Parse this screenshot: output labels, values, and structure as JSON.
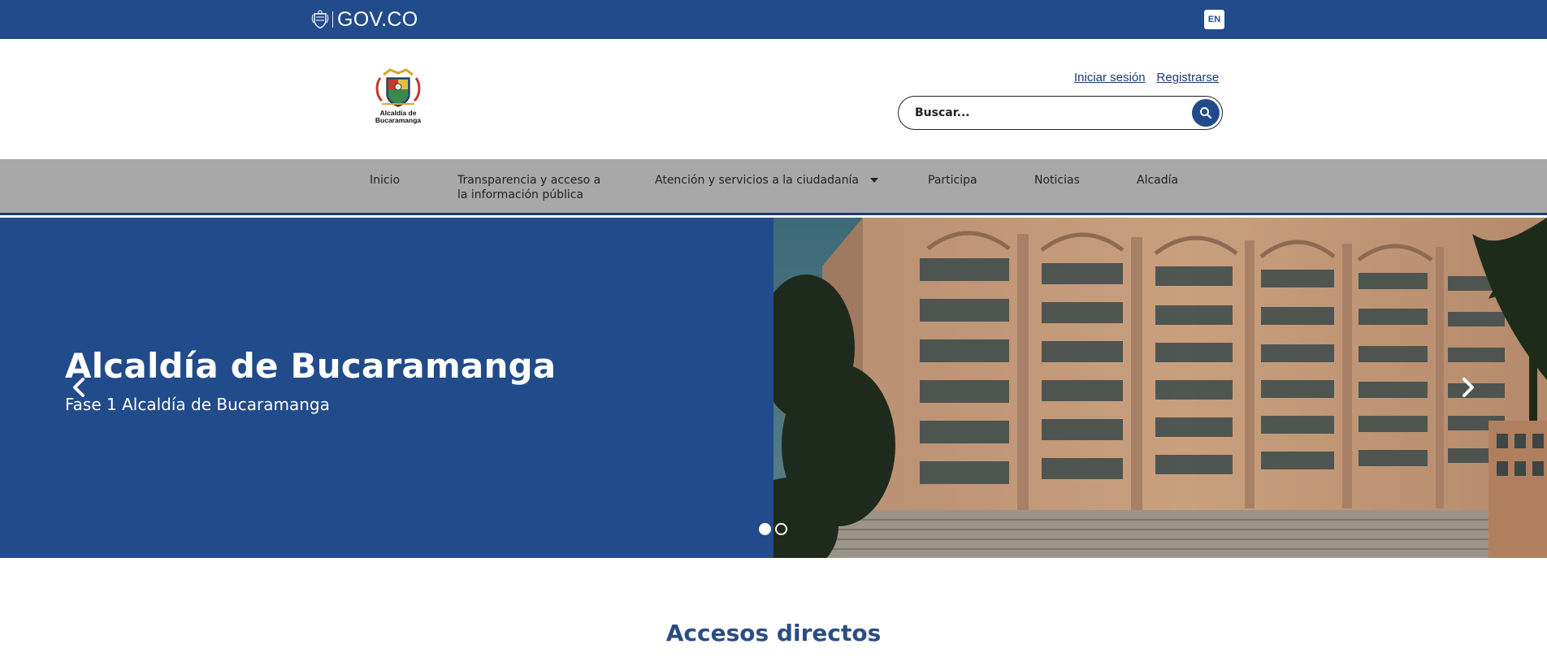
{
  "govbar": {
    "brand_text": "GOV.CO",
    "lang_label": "EN",
    "emblem_icon": "colombia-shield-icon"
  },
  "header": {
    "logo_icon": "alcaldia-bucaramanga-coat-of-arms",
    "logo_text_line1": "Alcaldía de",
    "logo_text_line2": "Bucaramanga",
    "login_label": "Iniciar sesión",
    "register_label": "Registrarse",
    "search_placeholder": "Buscar...",
    "search_icon": "search-icon"
  },
  "nav": {
    "items": [
      {
        "label": "Inicio"
      },
      {
        "label_line1": "Transparencia y acceso a",
        "label_line2": "la información pública"
      },
      {
        "label": "Atención y servicios a la ciudadanía",
        "has_dropdown": true
      },
      {
        "label": "Participa"
      },
      {
        "label": "Noticias"
      },
      {
        "label": "Alcadía"
      }
    ]
  },
  "hero": {
    "title": "Alcaldía de Bucaramanga",
    "subtitle": "Fase 1 Alcaldía de Bucaramanga",
    "slides_count": 2,
    "active_slide": 1,
    "prev_icon": "chevron-left-icon",
    "next_icon": "chevron-right-icon"
  },
  "section": {
    "title": "Accesos directos"
  },
  "colors": {
    "gov_blue": "#214b8a",
    "nav_gray": "#a8a8a8",
    "nav_border": "#1d3e74",
    "title_blue": "#2a4d84"
  }
}
